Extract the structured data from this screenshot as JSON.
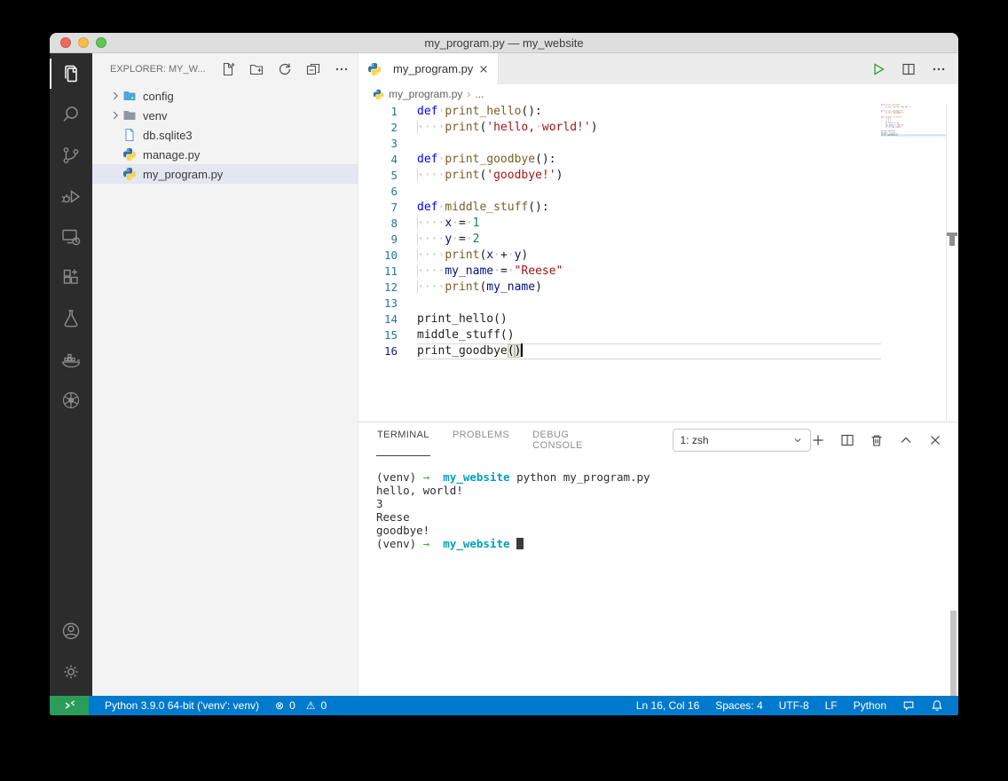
{
  "window": {
    "title": "my_program.py — my_website"
  },
  "activity_bar": {
    "items": [
      "explorer",
      "search",
      "source-control",
      "run-debug",
      "remote-explorer",
      "extensions",
      "testing",
      "docker",
      "kubernetes"
    ],
    "active": "explorer",
    "bottom_items": [
      "account",
      "settings"
    ]
  },
  "explorer": {
    "header": "EXPLORER: MY_W...",
    "actions": [
      "new-file",
      "new-folder",
      "refresh-explorer",
      "collapse-folders",
      "more-actions"
    ],
    "tree": [
      {
        "label": "config",
        "icon": "folder-config",
        "chevron": true,
        "selected": false
      },
      {
        "label": "venv",
        "icon": "folder",
        "chevron": true,
        "selected": false
      },
      {
        "label": "db.sqlite3",
        "icon": "file-database",
        "chevron": false,
        "selected": false
      },
      {
        "label": "manage.py",
        "icon": "python",
        "chevron": false,
        "selected": false
      },
      {
        "label": "my_program.py",
        "icon": "python",
        "chevron": false,
        "selected": true
      }
    ]
  },
  "editor": {
    "tab": {
      "label": "my_program.py",
      "icon": "python"
    },
    "actions": [
      "run-python-file",
      "split-editor",
      "more-actions"
    ],
    "breadcrumb": {
      "file": "my_program.py",
      "tail": "..."
    },
    "active_line": 16,
    "code_lines": [
      {
        "num": 1,
        "tokens": [
          [
            "kw",
            "def"
          ],
          [
            "ws",
            "·"
          ],
          [
            "fn",
            "print_hello"
          ],
          [
            "pl",
            "():"
          ]
        ]
      },
      {
        "num": 2,
        "tokens": [
          [
            "ind",
            "····"
          ],
          [
            "fn",
            "print"
          ],
          [
            "pl",
            "("
          ],
          [
            "str",
            "'hello,"
          ],
          [
            "ws",
            "·"
          ],
          [
            "str",
            "world!'"
          ],
          [
            "pl",
            ")"
          ]
        ]
      },
      {
        "num": 3,
        "tokens": []
      },
      {
        "num": 4,
        "tokens": [
          [
            "kw",
            "def"
          ],
          [
            "ws",
            "·"
          ],
          [
            "fn",
            "print_goodbye"
          ],
          [
            "pl",
            "():"
          ]
        ]
      },
      {
        "num": 5,
        "tokens": [
          [
            "ind",
            "····"
          ],
          [
            "fn",
            "print"
          ],
          [
            "pl",
            "("
          ],
          [
            "str",
            "'goodbye!'"
          ],
          [
            "pl",
            ")"
          ]
        ]
      },
      {
        "num": 6,
        "tokens": []
      },
      {
        "num": 7,
        "tokens": [
          [
            "kw",
            "def"
          ],
          [
            "ws",
            "·"
          ],
          [
            "fn",
            "middle_stuff"
          ],
          [
            "pl",
            "():"
          ]
        ]
      },
      {
        "num": 8,
        "tokens": [
          [
            "ind",
            "····"
          ],
          [
            "var",
            "x"
          ],
          [
            "ws",
            "·"
          ],
          [
            "pl",
            "="
          ],
          [
            "ws",
            "·"
          ],
          [
            "num",
            "1"
          ]
        ]
      },
      {
        "num": 9,
        "tokens": [
          [
            "ind",
            "····"
          ],
          [
            "var",
            "y"
          ],
          [
            "ws",
            "·"
          ],
          [
            "pl",
            "="
          ],
          [
            "ws",
            "·"
          ],
          [
            "num",
            "2"
          ]
        ]
      },
      {
        "num": 10,
        "tokens": [
          [
            "ind",
            "····"
          ],
          [
            "fn",
            "print"
          ],
          [
            "pl",
            "("
          ],
          [
            "var",
            "x"
          ],
          [
            "ws",
            "·"
          ],
          [
            "pl",
            "+"
          ],
          [
            "ws",
            "·"
          ],
          [
            "var",
            "y"
          ],
          [
            "pl",
            ")"
          ]
        ]
      },
      {
        "num": 11,
        "tokens": [
          [
            "ind",
            "····"
          ],
          [
            "var",
            "my_name"
          ],
          [
            "ws",
            "·"
          ],
          [
            "pl",
            "="
          ],
          [
            "ws",
            "·"
          ],
          [
            "str",
            "\"Reese\""
          ]
        ]
      },
      {
        "num": 12,
        "tokens": [
          [
            "ind",
            "····"
          ],
          [
            "fn",
            "print"
          ],
          [
            "pl",
            "("
          ],
          [
            "var",
            "my_name"
          ],
          [
            "pl",
            ")"
          ]
        ]
      },
      {
        "num": 13,
        "tokens": []
      },
      {
        "num": 14,
        "tokens": [
          [
            "pl",
            "print_hello()"
          ]
        ]
      },
      {
        "num": 15,
        "tokens": [
          [
            "pl",
            "middle_stuff()"
          ]
        ]
      },
      {
        "num": 16,
        "tokens": [
          [
            "pl",
            "print_goodbye"
          ],
          [
            "bm",
            "("
          ],
          [
            "bm",
            ")"
          ],
          [
            "caret",
            ""
          ]
        ]
      }
    ]
  },
  "panel": {
    "tabs": [
      {
        "label": "TERMINAL",
        "active": true
      },
      {
        "label": "PROBLEMS",
        "active": false
      },
      {
        "label": "DEBUG CONSOLE",
        "active": false
      }
    ],
    "shell_select": "1: zsh",
    "actions": [
      "new-terminal",
      "split-terminal",
      "kill-terminal",
      "maximize-panel",
      "close-panel"
    ],
    "terminal_lines": [
      [
        [
          "pl",
          "(venv) "
        ],
        [
          "arrow",
          "→"
        ],
        [
          "pl",
          "  "
        ],
        [
          "dir",
          "my_website"
        ],
        [
          "pl",
          " python my_program.py"
        ]
      ],
      [
        [
          "pl",
          "hello, world!"
        ]
      ],
      [
        [
          "pl",
          "3"
        ]
      ],
      [
        [
          "pl",
          "Reese"
        ]
      ],
      [
        [
          "pl",
          "goodbye!"
        ]
      ],
      [
        [
          "pl",
          "(venv) "
        ],
        [
          "arrow",
          "→"
        ],
        [
          "pl",
          "  "
        ],
        [
          "dir",
          "my_website"
        ],
        [
          "pl",
          " "
        ],
        [
          "block",
          ""
        ]
      ]
    ]
  },
  "status_bar": {
    "python_version": "Python 3.9.0 64-bit ('venv': venv)",
    "errors": "0",
    "warnings": "0",
    "ln_col": "Ln 16, Col 16",
    "spaces": "Spaces: 4",
    "encoding": "UTF-8",
    "eol": "LF",
    "language": "Python"
  },
  "colors": {
    "status_bar": "#007ACC",
    "remote_indicator": "#2C9C5B",
    "activity_bar": "#2C2C2C",
    "sidebar": "#F3F3F3",
    "selection": "#E4E6F1",
    "keyword": "#0000FF",
    "function": "#795E26",
    "string": "#A31515",
    "number": "#098658",
    "variable": "#001080",
    "terminal_dir": "#00A0BE",
    "terminal_arrow": "#35B729"
  }
}
